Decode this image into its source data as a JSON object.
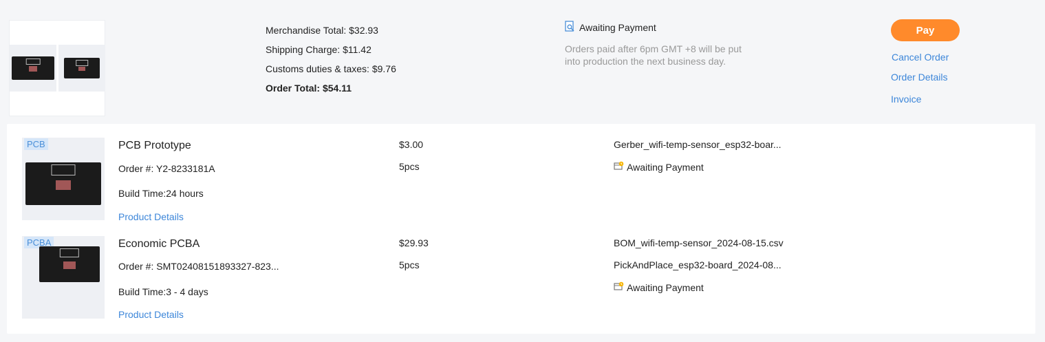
{
  "summary": {
    "merch_total": "Merchandise Total: $32.93",
    "shipping": "Shipping Charge: $11.42",
    "customs": "Customs duties & taxes: $9.76",
    "order_total": "Order Total: $54.11",
    "status": "Awaiting Payment",
    "note": "Orders paid after 6pm GMT +8 will be put into production the next business day.",
    "pay_label": "Pay",
    "cancel_label": "Cancel Order",
    "details_label": "Order Details",
    "invoice_label": "Invoice"
  },
  "items": [
    {
      "tag": "PCB",
      "name": "PCB Prototype",
      "order_no": "Order #: Y2-8233181A",
      "build_time": "Build Time:24 hours",
      "details_link": "Product Details",
      "price": "$3.00",
      "qty": "5pcs",
      "files": [
        "Gerber_wifi-temp-sensor_esp32-boar..."
      ],
      "status": "Awaiting Payment"
    },
    {
      "tag": "PCBA",
      "name": "Economic PCBA",
      "order_no": "Order #: SMT02408151893327-823...",
      "build_time": "Build Time:3 - 4 days",
      "details_link": "Product Details",
      "price": "$29.93",
      "qty": "5pcs",
      "files": [
        "BOM_wifi-temp-sensor_2024-08-15.csv",
        "PickAndPlace_esp32-board_2024-08..."
      ],
      "status": "Awaiting Payment"
    }
  ],
  "colors": {
    "accent": "#ff8a2b",
    "link": "#3c86d9",
    "muted": "#999999",
    "tag_bg": "#d5e6f9"
  },
  "icons": {
    "status_top": "document-search-icon",
    "status_item": "wallet-clock-icon"
  }
}
